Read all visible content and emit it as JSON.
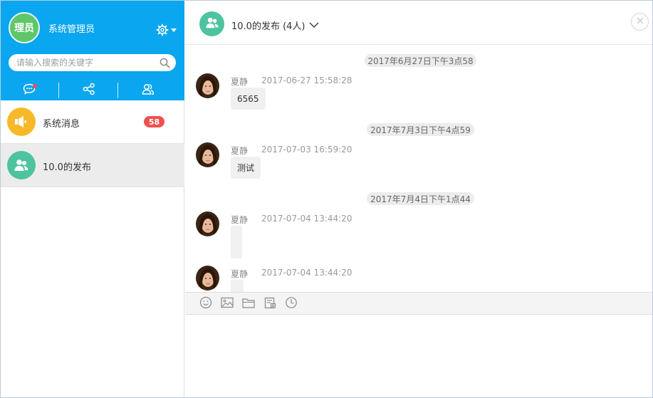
{
  "user": {
    "avatar_text": "理员",
    "name": "系统管理员"
  },
  "search": {
    "placeholder": "请输入搜索的关键字",
    "value": ""
  },
  "sidebar_tabs": [
    {
      "icon": "chat-bubble-icon",
      "has_unread_dot": true
    },
    {
      "icon": "share-icon"
    },
    {
      "icon": "contacts-icon"
    }
  ],
  "conversations": [
    {
      "name": "系统消息",
      "badge": "58",
      "icon": "speaker-icon",
      "color": "#f7b928",
      "active": false
    },
    {
      "name": "10.0的发布",
      "badge": "",
      "icon": "group-icon",
      "color": "#4dc39f",
      "active": true
    }
  ],
  "chat": {
    "title": "10.0的发布 (4人)",
    "date_separators": [
      "2017年6月27日下午3点58",
      "2017年7月3日下午4点59",
      "2017年7月4日下午1点44"
    ],
    "messages": [
      {
        "sender": "夏静",
        "time": "2017-06-27 15:58:28",
        "text": "6565"
      },
      {
        "sender": "夏静",
        "time": "2017-07-03 16:59:20",
        "text": "测试"
      },
      {
        "sender": "夏静",
        "time": "2017-07-04 13:44:20",
        "text": ""
      },
      {
        "sender": "夏静",
        "time": "2017-07-04 13:44:20",
        "text": ""
      }
    ]
  },
  "toolbar": [
    "emoji-icon",
    "image-icon",
    "folder-icon",
    "screenshot-icon",
    "history-icon"
  ],
  "compose": {
    "value": ""
  },
  "colors": {
    "header_blue": "#0aa6ef",
    "badge_red": "#f04f4f",
    "group_green": "#4dc39f",
    "system_yellow": "#f7b928",
    "user_green": "#5fc76a"
  }
}
